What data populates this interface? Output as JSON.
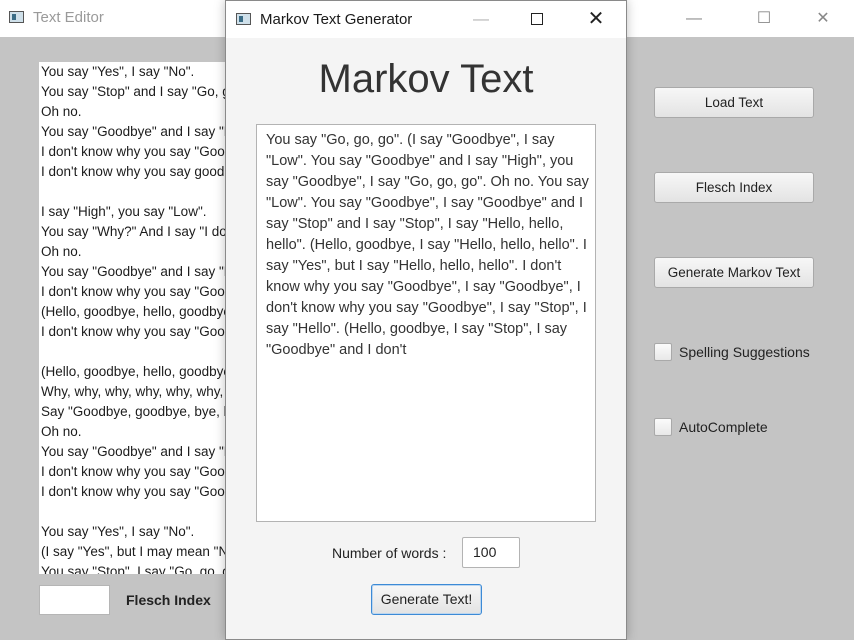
{
  "main_window": {
    "title": "Text Editor",
    "window_controls": {
      "minimize": "—",
      "maximize": "☐",
      "close": "✕"
    },
    "document_lines": [
      "You say \"Yes\", I say \"No\".",
      "You say \"Stop\" and I say \"Go, go, go\".",
      "Oh no.",
      "You say \"Goodbye\" and I say \"Hello, hello, hello\".",
      "I don't know why you say \"Goodbye\", I say \"Hello\".",
      "I don't know why you say goodbye, I say hello.",
      "",
      "I say \"High\", you say \"Low\".",
      "You say \"Why?\" And I say \"I don't know\".",
      "Oh no.",
      "You say \"Goodbye\" and I say \"Hello, hello, hello\".",
      "I don't know why you say \"Goodbye\", I say \"Hello\".",
      "(Hello, goodbye, hello, goodbye, hello, goodbye)",
      "I don't know why you say \"Goodbye\", I say \"Hello\".",
      "",
      "(Hello, goodbye, hello, goodbye, hello)",
      "Why, why, why, why, why, why, do you say goodbye?",
      "Say \"Goodbye, goodbye, bye, bye\".",
      "Oh no.",
      "You say \"Goodbye\" and I say \"Hello, hello, hello\".",
      "I don't know why you say \"Goodbye\", I say \"Hello\".",
      "I don't know why you say \"Goodbye\", I say \"Hello\".",
      "",
      "You say \"Yes\", I say \"No\".",
      "(I say \"Yes\", but I may mean \"No\")",
      "You say \"Stop\", I say \"Go, go, go\"."
    ],
    "flesch_input_value": "",
    "flesch_label": "Flesch Index",
    "buttons": {
      "load_text": "Load Text",
      "flesch_index": "Flesch Index",
      "generate_markov": "Generate Markov Text"
    },
    "checkboxes": {
      "spelling": "Spelling Suggestions",
      "autocomplete": "AutoComplete"
    }
  },
  "dialog": {
    "title": "Markov Text Generator",
    "window_controls": {
      "minimize": "—",
      "close": "✕"
    },
    "heading": "Markov Text",
    "generated_text": "You say \"Go, go, go\". (I say \"Goodbye\", I say \"Low\". You say \"Goodbye\" and I say \"High\", you say \"Goodbye\", I say \"Go, go, go\". Oh no. You say \"Low\". You say \"Goodbye\", I say \"Goodbye\" and I say \"Stop\" and I say \"Stop\", I say \"Hello, hello, hello\". (Hello, goodbye, I say \"Hello, hello, hello\". I say \"Yes\", but I say \"Hello, hello, hello\". I don't know why you say \"Goodbye\", I say \"Goodbye\", I don't know why you say \"Goodbye\", I say \"Stop\", I say \"Hello\". (Hello, goodbye, I say \"Stop\", I say \"Goodbye\" and I don't",
    "words_label": "Number of words :",
    "words_value": "100",
    "generate_button": "Generate Text!"
  }
}
